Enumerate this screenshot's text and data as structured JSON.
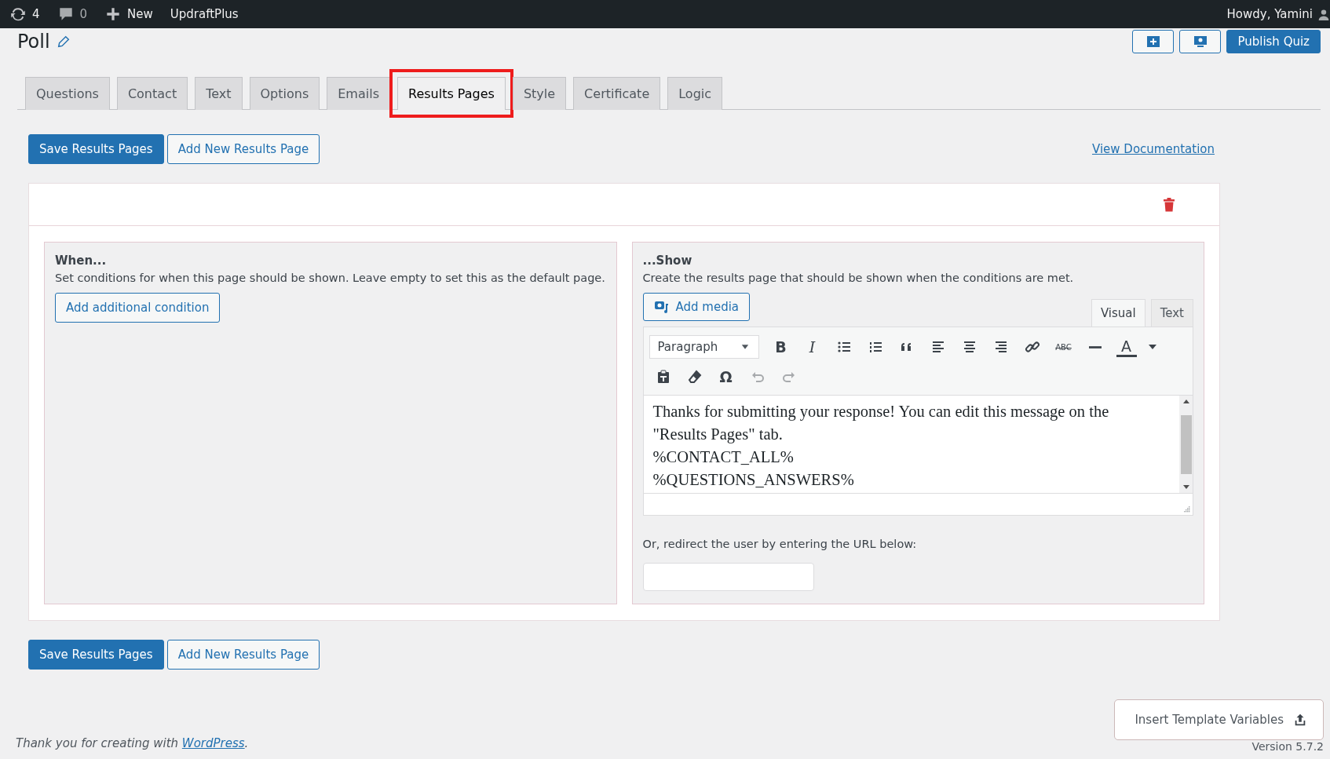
{
  "admin_bar": {
    "updates": "4",
    "comments": "0",
    "new": "New",
    "plugin": "UpdraftPlus",
    "greeting": "Howdy, Yamini"
  },
  "page": {
    "title": "Poll",
    "publish": "Publish Quiz"
  },
  "tabs": [
    {
      "label": "Questions",
      "selected": false
    },
    {
      "label": "Contact",
      "selected": false
    },
    {
      "label": "Text",
      "selected": false
    },
    {
      "label": "Options",
      "selected": false
    },
    {
      "label": "Emails",
      "selected": false
    },
    {
      "label": "Results Pages",
      "selected": true
    },
    {
      "label": "Style",
      "selected": false
    },
    {
      "label": "Certificate",
      "selected": false
    },
    {
      "label": "Logic",
      "selected": false
    }
  ],
  "actions_top": {
    "save": "Save Results Pages",
    "add": "Add New Results Page"
  },
  "doc_link": "View Documentation",
  "when": {
    "heading": "When...",
    "description": "Set conditions for when this page should be shown. Leave empty to set this as the default page.",
    "button": "Add additional condition"
  },
  "show": {
    "heading": "...Show",
    "description": "Create the results page that should be shown when the conditions are met.",
    "add_media": "Add media",
    "editor_tabs": [
      {
        "label": "Visual",
        "selected": true
      },
      {
        "label": "Text",
        "selected": false
      }
    ],
    "format": "Paragraph",
    "toolbar": [
      [
        {
          "kind": "bold",
          "glyph": "B",
          "disabled": false
        },
        {
          "kind": "italic",
          "glyph": "I",
          "disabled": false
        },
        {
          "kind": "bullet-list",
          "disabled": false
        },
        {
          "kind": "numbered-list",
          "disabled": false
        },
        {
          "kind": "blockquote",
          "disabled": false
        },
        {
          "kind": "align-left",
          "disabled": false
        },
        {
          "kind": "align-center",
          "disabled": false
        },
        {
          "kind": "align-right",
          "disabled": false
        },
        {
          "kind": "link",
          "disabled": false
        },
        {
          "kind": "strike",
          "glyph": "ABC",
          "disabled": false
        },
        {
          "kind": "rule",
          "disabled": false
        },
        {
          "kind": "color",
          "glyph": "A",
          "disabled": false
        },
        {
          "kind": "caret",
          "disabled": false
        }
      ],
      [
        {
          "kind": "paste",
          "disabled": false
        },
        {
          "kind": "eraser",
          "disabled": false
        },
        {
          "kind": "omega",
          "glyph": "Ω",
          "disabled": false
        },
        {
          "kind": "undo",
          "disabled": true
        },
        {
          "kind": "redo",
          "disabled": true
        }
      ]
    ],
    "content_lines": [
      "Thanks for submitting your response! You can edit this message on the \"Results Pages\" tab.",
      "%CONTACT_ALL%",
      "%QUESTIONS_ANSWERS%"
    ],
    "redirect_label": "Or, redirect the user by entering the URL below:"
  },
  "actions_bottom": {
    "save": "Save Results Pages",
    "add": "Add New Results Page"
  },
  "template_button": "Insert Template Variables",
  "footer": {
    "text": "Thank you for creating with ",
    "link": "WordPress",
    "suffix": "."
  },
  "version": "Version 5.7.2"
}
